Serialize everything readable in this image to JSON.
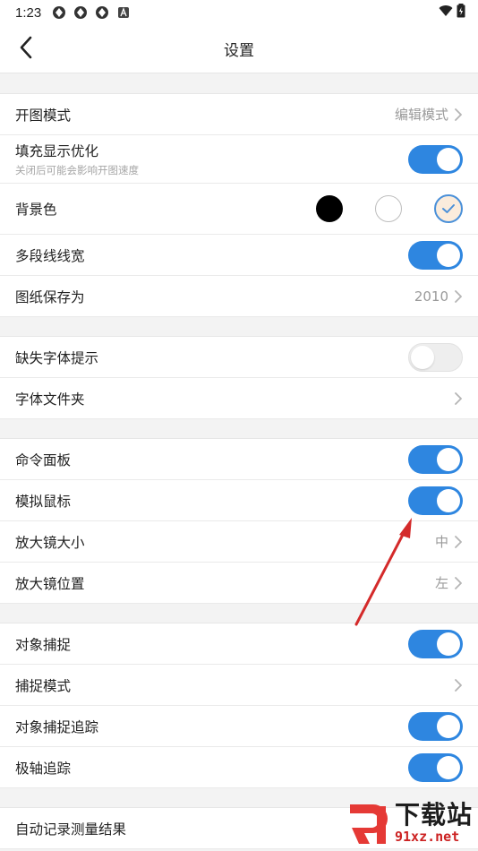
{
  "status_bar": {
    "time": "1:23",
    "icons": [
      "app-icon-1",
      "app-icon-2",
      "app-icon-3",
      "a-notification-icon"
    ],
    "right_icons": [
      "wifi-icon",
      "battery-icon"
    ]
  },
  "header": {
    "title": "设置",
    "back_icon": "chevron-left-icon"
  },
  "sections": [
    {
      "rows": [
        {
          "label": "开图模式",
          "value": "编辑模式",
          "control": "chevron"
        },
        {
          "label": "填充显示优化",
          "sub": "关闭后可能会影响开图速度",
          "control": "toggle",
          "on": true
        },
        {
          "label": "背景色",
          "control": "swatches",
          "options": [
            "black",
            "white",
            "beige"
          ],
          "selected": "beige"
        },
        {
          "label": "多段线线宽",
          "control": "toggle",
          "on": true
        },
        {
          "label": "图纸保存为",
          "value": "2010",
          "control": "chevron"
        }
      ]
    },
    {
      "rows": [
        {
          "label": "缺失字体提示",
          "control": "toggle",
          "on": false
        },
        {
          "label": "字体文件夹",
          "control": "chevron"
        }
      ]
    },
    {
      "rows": [
        {
          "label": "命令面板",
          "control": "toggle",
          "on": true
        },
        {
          "label": "模拟鼠标",
          "control": "toggle",
          "on": true
        },
        {
          "label": "放大镜大小",
          "value": "中",
          "control": "chevron"
        },
        {
          "label": "放大镜位置",
          "value": "左",
          "control": "chevron"
        }
      ]
    },
    {
      "rows": [
        {
          "label": "对象捕捉",
          "control": "toggle",
          "on": true
        },
        {
          "label": "捕捉模式",
          "control": "chevron"
        },
        {
          "label": "对象捕捉追踪",
          "control": "toggle",
          "on": true
        },
        {
          "label": "极轴追踪",
          "control": "toggle",
          "on": true
        }
      ]
    },
    {
      "rows": [
        {
          "label": "自动记录测量结果",
          "control": "none"
        }
      ]
    }
  ],
  "colors": {
    "accent": "#2e86e0",
    "annotation_arrow": "#d42a2a",
    "selected_swatch": "#fbecdc"
  },
  "watermark": {
    "title": "下载站",
    "url": "91xz.net"
  }
}
